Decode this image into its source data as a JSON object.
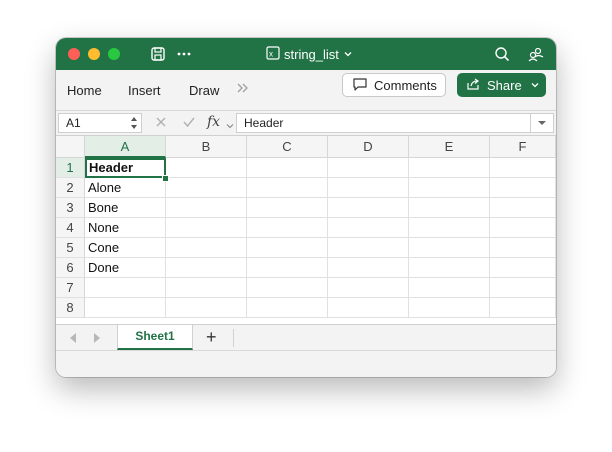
{
  "titlebar": {
    "doc_title": "string_list",
    "doc_icon": "excel-file-icon"
  },
  "ribbon": {
    "tabs": [
      "Home",
      "Insert",
      "Draw"
    ],
    "comments_label": "Comments",
    "share_label": "Share"
  },
  "formula_bar": {
    "name_box": "A1",
    "fx_label": "fx",
    "formula": "Header"
  },
  "grid": {
    "columns": [
      "A",
      "B",
      "C",
      "D",
      "E",
      "F"
    ],
    "rows": [
      "1",
      "2",
      "3",
      "4",
      "5",
      "6",
      "7",
      "8"
    ],
    "column_a": [
      "Header",
      "Alone",
      "Bone",
      "None",
      "Cone",
      "Done",
      "",
      ""
    ],
    "active_cell": "A1"
  },
  "sheets": {
    "tabs": [
      "Sheet1"
    ],
    "add_label": "+"
  },
  "colors": {
    "accent": "#217346"
  }
}
